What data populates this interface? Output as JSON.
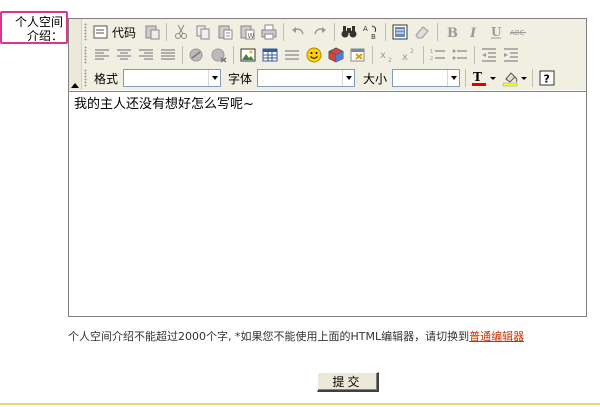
{
  "field": {
    "label": "个人空间介绍："
  },
  "toolbar": {
    "code_label": "代码",
    "format_label": "格式",
    "font_label": "字体",
    "size_label": "大小",
    "format_value": "",
    "font_value": "",
    "size_value": "",
    "buttons": [
      "source-code",
      "paste",
      "cut",
      "copy",
      "paste-text",
      "paste-word",
      "print",
      "undo",
      "redo",
      "find",
      "replace",
      "select-all",
      "remove-format",
      "bold",
      "italic",
      "underline",
      "strikethrough",
      "align-left",
      "align-center",
      "align-right",
      "justify",
      "link",
      "unlink",
      "image",
      "table",
      "horizontal-rule",
      "smiley",
      "special-char",
      "flash",
      "subscript",
      "superscript",
      "ordered-list",
      "unordered-list",
      "outdent",
      "indent",
      "text-color",
      "background-color",
      "about"
    ]
  },
  "editor": {
    "content": "我的主人还没有想好怎么写呢~"
  },
  "hint": {
    "text": "个人空间介绍不能超过2000个字, *如果您不能使用上面的HTML编辑器，请切换到",
    "link": "普通编辑器"
  },
  "submit": {
    "label": "提交"
  },
  "colors": {
    "label_border": "#e0338d",
    "link": "#cc3300",
    "toolbar_bg": "#f1efe2",
    "bottom_line": "#f4d06f"
  }
}
